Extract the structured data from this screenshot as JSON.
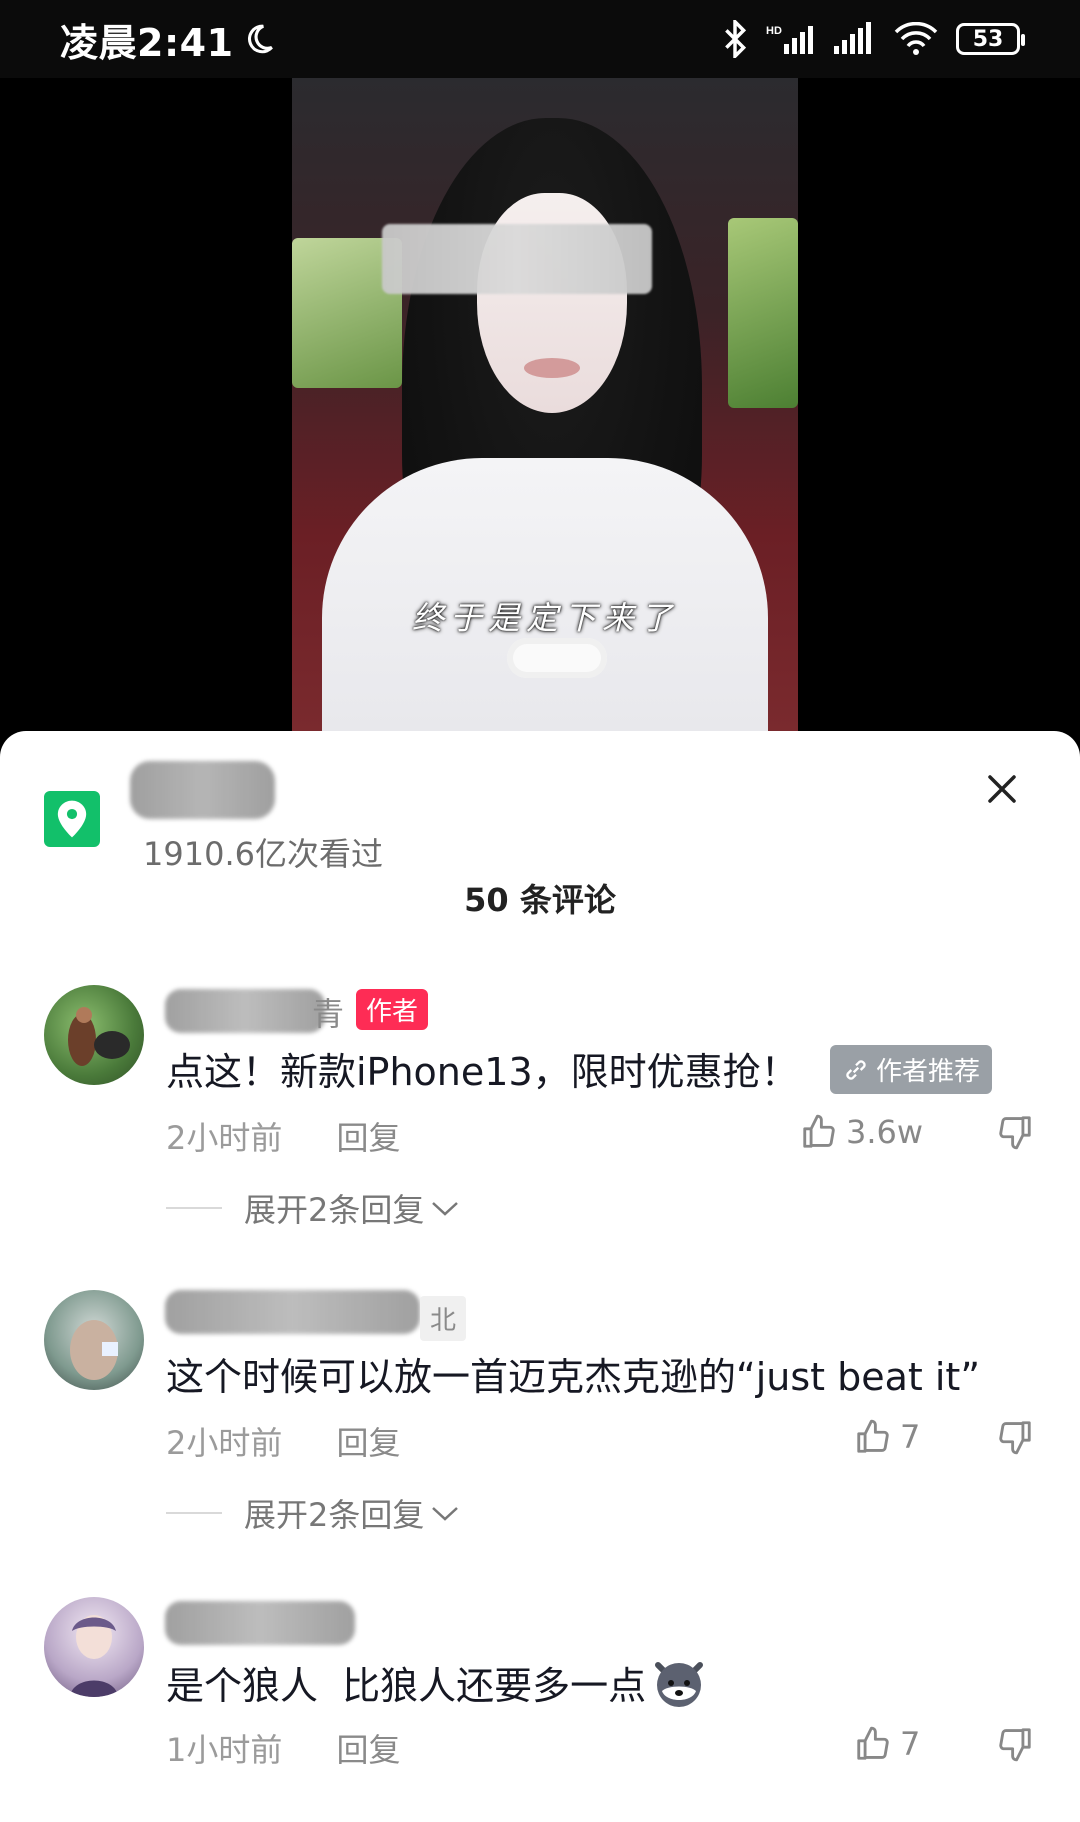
{
  "status_bar": {
    "time": "凌晨2:41",
    "battery": "53"
  },
  "video": {
    "subtitle": "终于是定下来了"
  },
  "location": {
    "views": "1910.6亿次看过"
  },
  "comments_header": {
    "count_label": "50 条评论"
  },
  "comments": [
    {
      "name_tail": "青",
      "author_tag": "作者",
      "text": "点这！新款iPhone13，限时优惠抢！",
      "rec_tag": "作者推荐",
      "time": "2小时前",
      "reply_label": "回复",
      "likes": "3.6w",
      "expand_label": "展开2条回复"
    },
    {
      "region_tag": "北",
      "text": "这个时候可以放一首迈克杰克逊的“just beat it”",
      "time": "2小时前",
      "reply_label": "回复",
      "likes": "7",
      "expand_label": "展开2条回复"
    },
    {
      "text": "是个狼人  比狼人还要多一点",
      "time": "1小时前",
      "reply_label": "回复",
      "likes": "7"
    }
  ],
  "colors": {
    "location_green": "#12c06a",
    "author_red": "#fe2c55"
  }
}
